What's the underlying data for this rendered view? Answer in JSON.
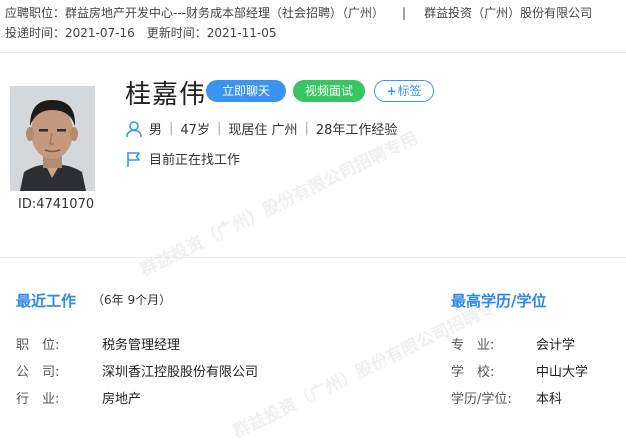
{
  "header": {
    "position_applied_label": "应聘职位：",
    "position_applied_value": "群益房地产开发中心---财务成本部经理（社会招聘）（广州）",
    "divider": "|",
    "company": "群益投资（广州）股份有限公司",
    "submit_time_label": "投递时间：",
    "submit_time_value": "2021-07-16",
    "update_time_label": "更新时间：",
    "update_time_value": "2021-11-05"
  },
  "candidate": {
    "name": "桂嘉伟",
    "id_label": "ID:4741070",
    "gender": "男",
    "age": "47岁",
    "residence": "现居住 广州",
    "experience": "28年工作经验",
    "job_status": "目前正在找工作"
  },
  "actions": {
    "chat": "立即聊天",
    "video": "视频面试",
    "tag": "标签"
  },
  "icons": {
    "person": "person-icon",
    "flag": "flag-icon",
    "plus": "plus-icon"
  },
  "colors": {
    "accent_blue": "#3b95f0",
    "accent_green": "#3ac564",
    "section_title": "#2f88e6"
  },
  "recent_work": {
    "title": "最近工作",
    "duration": "（6年 9个月）",
    "rows": [
      {
        "label": "职　位:",
        "value": "税务管理经理"
      },
      {
        "label": "公　司:",
        "value": "深圳香江控股股份有限公司"
      },
      {
        "label": "行　业:",
        "value": "房地产"
      }
    ]
  },
  "education": {
    "title": "最高学历/学位",
    "rows": [
      {
        "label": "专　业:",
        "value": "会计学"
      },
      {
        "label": "学　校:",
        "value": "中山大学"
      },
      {
        "label": "学历/学位:",
        "value": "本科"
      }
    ]
  },
  "watermark": {
    "text": "群益投资（广州）股份有限公司招聘专用"
  }
}
